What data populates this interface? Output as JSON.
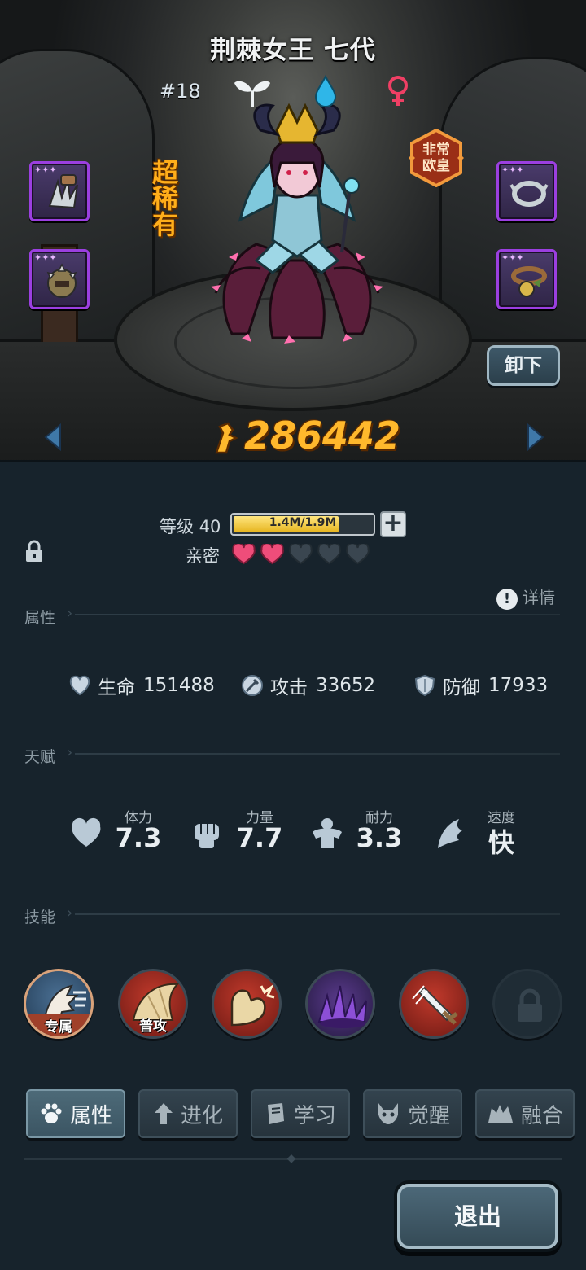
{
  "hero": {
    "name": "荆棘女王 七代",
    "number": "#18",
    "rarity": "超稀有",
    "luck_badge": "非常\n欧皇",
    "power": "286442",
    "unequip_label": "卸下",
    "colors": {
      "rarity": "#ffae1a",
      "power": "#ffb82c"
    }
  },
  "level": {
    "label": "等级 40",
    "xp_text": "1.4M/1.9M",
    "xp_fraction": 0.74,
    "plus_icon": "plus-icon"
  },
  "intimacy": {
    "label": "亲密",
    "filled": 2,
    "total": 5
  },
  "sections": {
    "attributes": "属性",
    "talent": "天赋",
    "skills": "技能"
  },
  "detail_label": "详情",
  "attributes": [
    {
      "icon": "heart-shield-icon",
      "label": "生命",
      "value": "151488"
    },
    {
      "icon": "sword-icon",
      "label": "攻击",
      "value": "33652"
    },
    {
      "icon": "shield-icon",
      "label": "防御",
      "value": "17933"
    }
  ],
  "talents": [
    {
      "icon": "heart-icon",
      "label": "体力",
      "value": "7.3"
    },
    {
      "icon": "fist-icon",
      "label": "力量",
      "value": "7.7"
    },
    {
      "icon": "muscle-icon",
      "label": "耐力",
      "value": "3.3"
    },
    {
      "icon": "wing-icon",
      "label": "速度",
      "value": "快"
    }
  ],
  "skills": [
    {
      "icon": "dragon-icon",
      "label": "专属"
    },
    {
      "icon": "claw-icon",
      "label": "普攻"
    },
    {
      "icon": "flex-arm-icon",
      "label": ""
    },
    {
      "icon": "purple-spikes-icon",
      "label": ""
    },
    {
      "icon": "broken-sword-icon",
      "label": ""
    },
    {
      "icon": "lock-icon",
      "label": ""
    }
  ],
  "tabs": [
    {
      "icon": "paw-icon",
      "label": "属性",
      "active": true
    },
    {
      "icon": "arrow-up-icon",
      "label": "进化",
      "active": false
    },
    {
      "icon": "book-icon",
      "label": "学习",
      "active": false
    },
    {
      "icon": "demon-icon",
      "label": "觉醒",
      "active": false
    },
    {
      "icon": "fusion-icon",
      "label": "融合",
      "active": false
    }
  ],
  "exit_label": "退出"
}
